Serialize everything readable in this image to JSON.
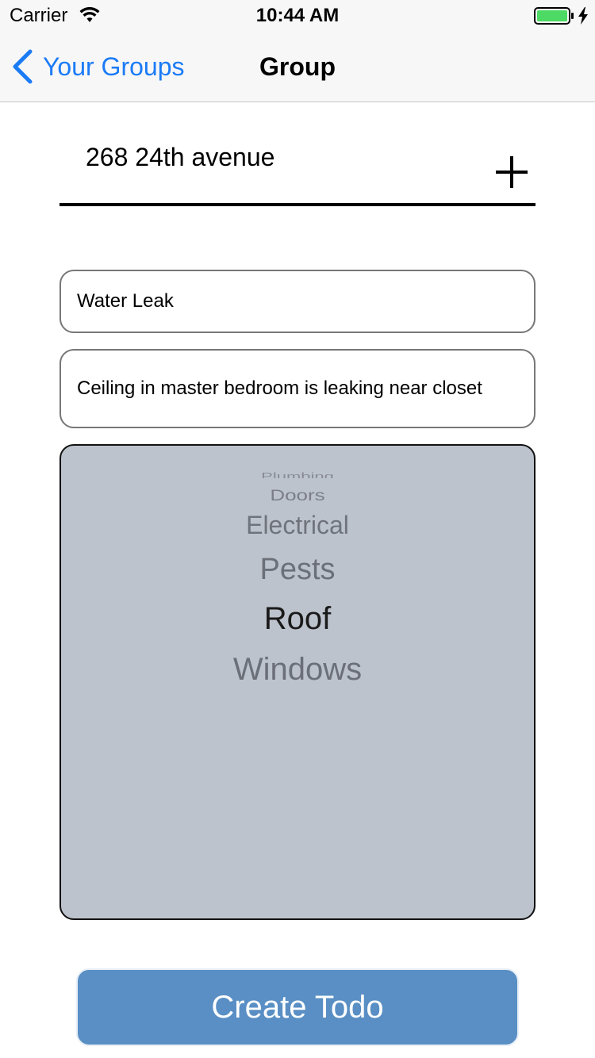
{
  "status_bar": {
    "carrier": "Carrier",
    "time": "10:44 AM",
    "battery_color": "#4cd964"
  },
  "nav": {
    "back_label": "Your Groups",
    "title": "Group",
    "tint_color": "#1b7bf6"
  },
  "address": {
    "label": "268 24th avenue"
  },
  "form": {
    "title_value": "Water Leak",
    "description_value": "Ceiling in master bedroom is leaking near closet"
  },
  "picker": {
    "options": [
      "Plumbing",
      "Doors",
      "Electrical",
      "Pests",
      "Roof",
      "Windows"
    ],
    "selected": "Roof",
    "background_color": "#bdc3cd"
  },
  "actions": {
    "create_label": "Create Todo",
    "create_color": "#598fc4"
  }
}
